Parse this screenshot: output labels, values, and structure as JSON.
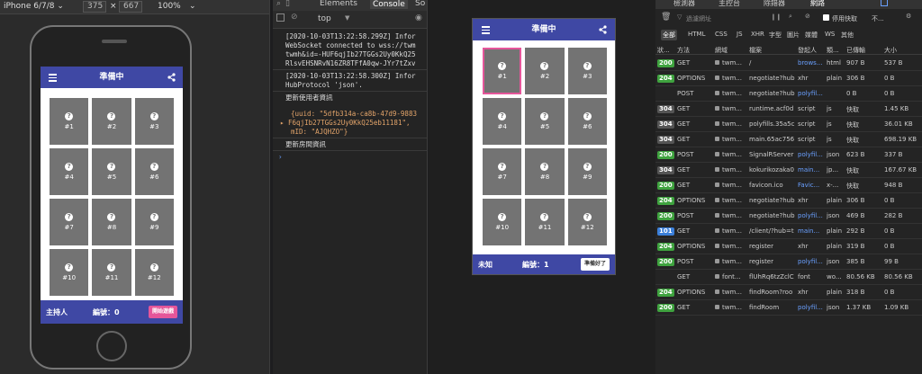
{
  "devtoolbar": {
    "device": "iPhone 6/7/8 ⌄",
    "width": "375",
    "times": "×",
    "height": "667",
    "zoom": "100%",
    "zoom_caret": "⌄"
  },
  "app_left": {
    "title": "準備中",
    "cards": [
      "#1",
      "#2",
      "#3",
      "#4",
      "#5",
      "#6",
      "#7",
      "#8",
      "#9",
      "#10",
      "#11",
      "#12"
    ],
    "role": "主持人",
    "number_label": "編號：0",
    "action_button": "開始遊戲",
    "action_color": "#e5569a"
  },
  "app_mid": {
    "title": "準備中",
    "cards": [
      "#1",
      "#2",
      "#3",
      "#4",
      "#5",
      "#6",
      "#7",
      "#8",
      "#9",
      "#10",
      "#11",
      "#12"
    ],
    "selected_card": "#1",
    "role": "未知",
    "number_label": "編號：1",
    "action_button": "準備好了"
  },
  "console": {
    "tabs": [
      "Elements",
      "Console",
      "So"
    ],
    "context": "top",
    "context_caret": "▼",
    "lines_block1": [
      "[2020-10-03T13:22:58.299Z] Infor",
      "WebSocket connected to wss://twm",
      "twmh&id=-HUF6qjIb27TGGs2Uy0KkQ25",
      "RlsvEHSNRvN16ZR8TFfA0qw-JYr7tZxv"
    ],
    "lines_block2": [
      "[2020-10-03T13:22:58.300Z] Infor",
      "HubProtocol 'json'."
    ],
    "update_user": "更新使用者資訊",
    "obj_line1": "{uuid: \"5dfb314a-ca8b-47d9-9883",
    "obj_line2": "F6qjIb27TGGs2Uy0KkQ25eb11181\",",
    "obj_line3": "mID: \"AJQHZO\"}",
    "update_room": "更新房間資訊"
  },
  "network": {
    "top_tabs": [
      "檢測器",
      "主控台",
      "除錯器",
      "網路"
    ],
    "filter_placeholder": "過濾網址",
    "disable_cache": "停用快取",
    "throttle": "不...",
    "filters": [
      "全部",
      "HTML",
      "CSS",
      "JS",
      "XHR",
      "字型",
      "圖片",
      "媒體",
      "WS",
      "其他"
    ],
    "headers": [
      "狀...",
      "方法",
      "網域",
      "檔案",
      "發起人",
      "類...",
      "已傳輸",
      "大小"
    ],
    "rows": [
      {
        "status": "200",
        "method": "GET",
        "domain": "twm...",
        "file": "/",
        "initiator": "brows...",
        "type": "html",
        "transferred": "907 B",
        "size": "537 B"
      },
      {
        "status": "204",
        "method": "OPTIONS",
        "domain": "twm...",
        "file": "negotiate?hub",
        "initiator": "xhr",
        "type": "plain",
        "transferred": "306 B",
        "size": "0 B"
      },
      {
        "status": "",
        "method": "POST",
        "domain": "twm...",
        "file": "negotiate?hub",
        "initiator": "polyfil...",
        "type": "",
        "transferred": "0 B",
        "size": "0 B"
      },
      {
        "status": "304",
        "method": "GET",
        "domain": "twm...",
        "file": "runtime.acf0d",
        "initiator": "script",
        "type": "js",
        "transferred": "快取",
        "size": "1.45 KB"
      },
      {
        "status": "304",
        "method": "GET",
        "domain": "twm...",
        "file": "polyfills.35a5c",
        "initiator": "script",
        "type": "js",
        "transferred": "快取",
        "size": "36.01 KB"
      },
      {
        "status": "304",
        "method": "GET",
        "domain": "twm...",
        "file": "main.65ac756",
        "initiator": "script",
        "type": "js",
        "transferred": "快取",
        "size": "698.19 KB"
      },
      {
        "status": "200",
        "method": "POST",
        "domain": "twm...",
        "file": "SignalRServer",
        "initiator": "polyfil...",
        "type": "json",
        "transferred": "623 B",
        "size": "337 B"
      },
      {
        "status": "304",
        "method": "GET",
        "domain": "twm...",
        "file": "kokurikozaka0",
        "initiator": "main...",
        "type": "jp...",
        "transferred": "快取",
        "size": "167.67 KB"
      },
      {
        "status": "200",
        "method": "GET",
        "domain": "twm...",
        "file": "favicon.ico",
        "initiator": "Favic...",
        "type": "x-...",
        "transferred": "快取",
        "size": "948 B"
      },
      {
        "status": "204",
        "method": "OPTIONS",
        "domain": "twm...",
        "file": "negotiate?hub",
        "initiator": "xhr",
        "type": "plain",
        "transferred": "306 B",
        "size": "0 B"
      },
      {
        "status": "200",
        "method": "POST",
        "domain": "twm...",
        "file": "negotiate?hub",
        "initiator": "polyfil...",
        "type": "json",
        "transferred": "469 B",
        "size": "282 B"
      },
      {
        "status": "101",
        "method": "GET",
        "domain": "twm...",
        "file": "/client/?hub=t",
        "initiator": "main...",
        "type": "plain",
        "transferred": "292 B",
        "size": "0 B"
      },
      {
        "status": "204",
        "method": "OPTIONS",
        "domain": "twm...",
        "file": "register",
        "initiator": "xhr",
        "type": "plain",
        "transferred": "319 B",
        "size": "0 B"
      },
      {
        "status": "200",
        "method": "POST",
        "domain": "twm...",
        "file": "register",
        "initiator": "polyfil...",
        "type": "json",
        "transferred": "385 B",
        "size": "99 B"
      },
      {
        "status": "",
        "method": "GET",
        "domain": "font...",
        "file": "flUhRq6tzZclC",
        "initiator": "font",
        "type": "wo...",
        "transferred": "80.56 KB",
        "size": "80.56 KB"
      },
      {
        "status": "204",
        "method": "OPTIONS",
        "domain": "twm...",
        "file": "findRoom?roo",
        "initiator": "xhr",
        "type": "plain",
        "transferred": "318 B",
        "size": "0 B"
      },
      {
        "status": "200",
        "method": "GET",
        "domain": "twm...",
        "file": "findRoom",
        "initiator": "polyfil...",
        "type": "json",
        "transferred": "1.37 KB",
        "size": "1.09 KB"
      }
    ],
    "status_colors": {
      "200": "#3fa33f",
      "204": "#3fa33f",
      "304": "#555555",
      "101": "#3b7fd9"
    }
  }
}
